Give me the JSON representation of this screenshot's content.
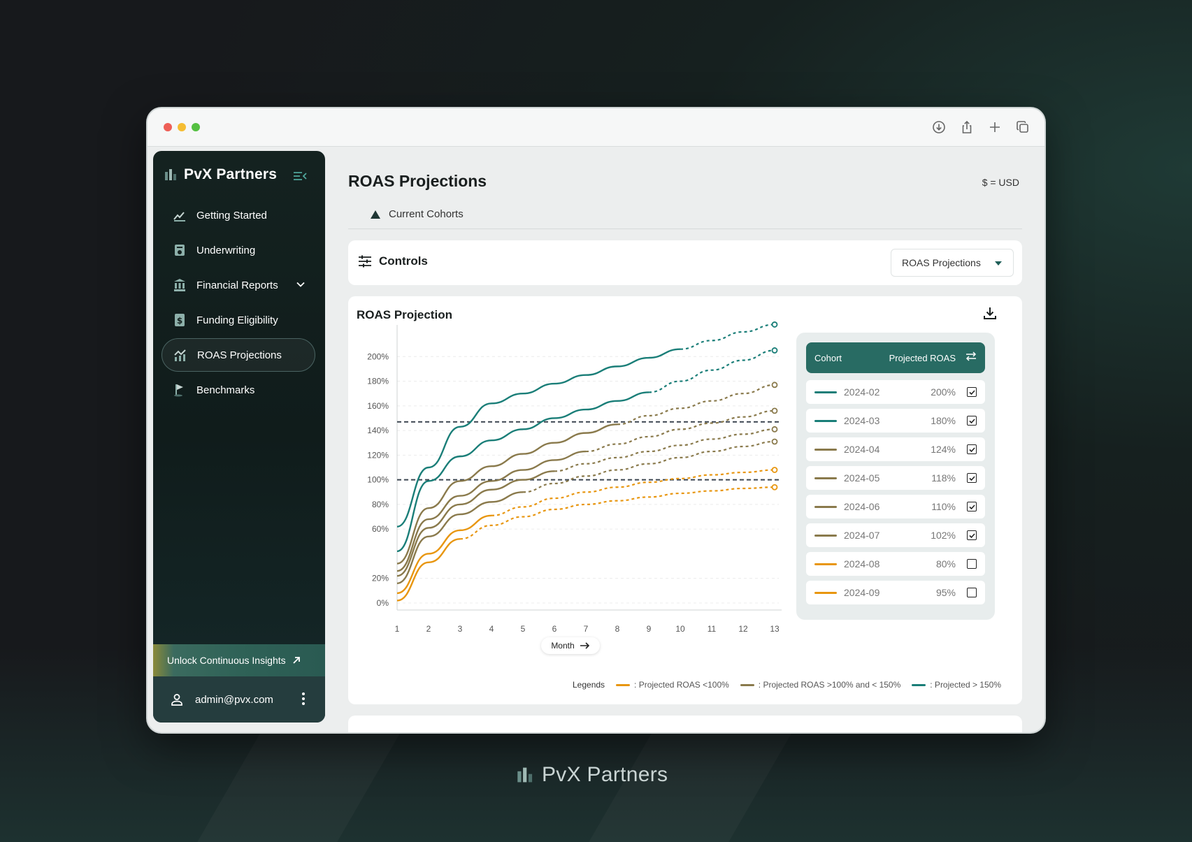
{
  "window": {
    "toolbar_icons": [
      "download-circle-icon",
      "share-icon",
      "plus-icon",
      "copy-icon"
    ]
  },
  "sidebar": {
    "brand": "PvX Partners",
    "items": [
      {
        "label": "Getting Started",
        "icon": "getting-started-icon"
      },
      {
        "label": "Underwriting",
        "icon": "underwriting-icon"
      },
      {
        "label": "Financial Reports",
        "icon": "bank-icon",
        "expandable": true
      },
      {
        "label": "Funding Eligibility",
        "icon": "dollar-doc-icon"
      },
      {
        "label": "ROAS Projections",
        "icon": "trend-chart-icon",
        "active": true
      },
      {
        "label": "Benchmarks",
        "icon": "flag-icon"
      }
    ],
    "unlock_label": "Unlock Continuous Insights",
    "user_email": "admin@pvx.com"
  },
  "main": {
    "title": "ROAS Projections",
    "currency": "$ = USD",
    "tab": "Current Cohorts",
    "controls_label": "Controls",
    "select_value": "ROAS Projections",
    "chart_title": "ROAS Projection",
    "legend_panel": {
      "col_cohort": "Cohort",
      "col_roas": "Projected ROAS"
    },
    "month_label": "Month",
    "legends": {
      "label": "Legends",
      "items": [
        {
          "color": "#e8960f",
          "text": ": Projected ROAS <100%"
        },
        {
          "color": "#8a7a4c",
          "text": ": Projected ROAS >100% and < 150%"
        },
        {
          "color": "#1a7e78",
          "text": ": Projected > 150%"
        }
      ]
    }
  },
  "footer_brand": "PvX Partners",
  "colors": {
    "teal": "#1a7e78",
    "olive": "#8a7a4c",
    "orange": "#e8960f",
    "threshold": "#3b4550"
  },
  "chart_data": {
    "type": "line",
    "xlabel": "Month",
    "x": [
      1,
      2,
      3,
      4,
      5,
      6,
      7,
      8,
      9,
      10,
      11,
      12,
      13
    ],
    "ylim": [
      0,
      220
    ],
    "yticks": [
      0,
      20,
      60,
      80,
      100,
      120,
      140,
      160,
      180,
      200
    ],
    "ytick_labels": [
      "0%",
      "20%",
      "60%",
      "80%",
      "100%",
      "120%",
      "140%",
      "160%",
      "180%",
      "200%"
    ],
    "thresholds": [
      100,
      147
    ],
    "series": [
      {
        "name": "2024-02",
        "color": "#1a7e78",
        "roas": "200%",
        "checked": true,
        "actual_until": 10,
        "values": [
          62,
          110,
          143,
          162,
          170,
          178,
          185,
          192,
          199,
          206,
          213,
          220,
          226
        ]
      },
      {
        "name": "2024-03",
        "color": "#1a7e78",
        "roas": "180%",
        "checked": true,
        "actual_until": 9,
        "values": [
          42,
          99,
          119,
          132,
          141,
          150,
          157,
          164,
          171,
          180,
          189,
          197,
          205
        ]
      },
      {
        "name": "2024-04",
        "color": "#8a7a4c",
        "roas": "124%",
        "checked": true,
        "actual_until": 8,
        "values": [
          32,
          77,
          99,
          111,
          121,
          130,
          138,
          145,
          152,
          158,
          164,
          170,
          177
        ]
      },
      {
        "name": "2024-05",
        "color": "#8a7a4c",
        "roas": "118%",
        "checked": true,
        "actual_until": 7,
        "values": [
          26,
          68,
          87,
          99,
          108,
          116,
          123,
          129,
          135,
          141,
          146,
          151,
          156
        ]
      },
      {
        "name": "2024-06",
        "color": "#8a7a4c",
        "roas": "110%",
        "checked": true,
        "actual_until": 6,
        "values": [
          22,
          61,
          80,
          92,
          100,
          107,
          113,
          118,
          123,
          128,
          133,
          137,
          141
        ]
      },
      {
        "name": "2024-07",
        "color": "#8a7a4c",
        "roas": "102%",
        "checked": true,
        "actual_until": 5,
        "values": [
          16,
          54,
          72,
          82,
          90,
          97,
          103,
          108,
          113,
          118,
          123,
          127,
          131
        ]
      },
      {
        "name": "2024-08",
        "color": "#e8960f",
        "roas": "80%",
        "checked": false,
        "actual_until": 4,
        "values": [
          8,
          40,
          59,
          71,
          78,
          85,
          90,
          94,
          98,
          101,
          104,
          106,
          108
        ]
      },
      {
        "name": "2024-09",
        "color": "#e8960f",
        "roas": "95%",
        "checked": false,
        "actual_until": 3,
        "values": [
          2,
          33,
          52,
          63,
          70,
          76,
          80,
          83,
          86,
          89,
          91,
          93,
          94
        ]
      }
    ]
  }
}
